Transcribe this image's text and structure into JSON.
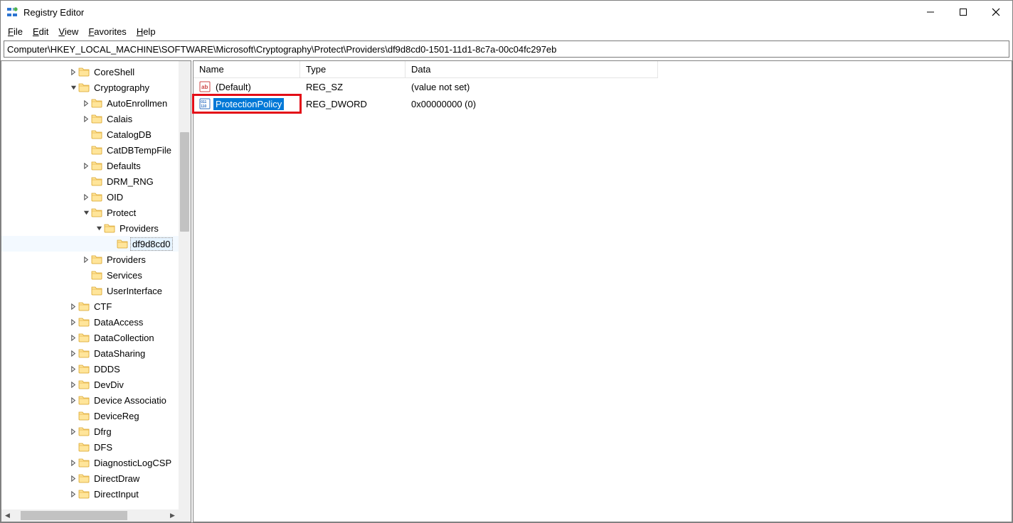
{
  "window": {
    "title": "Registry Editor"
  },
  "menu": {
    "file": "File",
    "edit": "Edit",
    "view": "View",
    "favorites": "Favorites",
    "help": "Help"
  },
  "address": "Computer\\HKEY_LOCAL_MACHINE\\SOFTWARE\\Microsoft\\Cryptography\\Protect\\Providers\\df9d8cd0-1501-11d1-8c7a-00c04fc297eb",
  "tree": [
    {
      "label": "CoreShell",
      "depth": 5,
      "caret": "right"
    },
    {
      "label": "Cryptography",
      "depth": 5,
      "caret": "down"
    },
    {
      "label": "AutoEnrollmen",
      "depth": 6,
      "caret": "right"
    },
    {
      "label": "Calais",
      "depth": 6,
      "caret": "right"
    },
    {
      "label": "CatalogDB",
      "depth": 6,
      "caret": "none"
    },
    {
      "label": "CatDBTempFile",
      "depth": 6,
      "caret": "none"
    },
    {
      "label": "Defaults",
      "depth": 6,
      "caret": "right"
    },
    {
      "label": "DRM_RNG",
      "depth": 6,
      "caret": "none"
    },
    {
      "label": "OID",
      "depth": 6,
      "caret": "right"
    },
    {
      "label": "Protect",
      "depth": 6,
      "caret": "down"
    },
    {
      "label": "Providers",
      "depth": 7,
      "caret": "down"
    },
    {
      "label": "df9d8cd0",
      "depth": 8,
      "caret": "none",
      "selected": true
    },
    {
      "label": "Providers",
      "depth": 6,
      "caret": "right"
    },
    {
      "label": "Services",
      "depth": 6,
      "caret": "none"
    },
    {
      "label": "UserInterface",
      "depth": 6,
      "caret": "none"
    },
    {
      "label": "CTF",
      "depth": 5,
      "caret": "right"
    },
    {
      "label": "DataAccess",
      "depth": 5,
      "caret": "right"
    },
    {
      "label": "DataCollection",
      "depth": 5,
      "caret": "right"
    },
    {
      "label": "DataSharing",
      "depth": 5,
      "caret": "right"
    },
    {
      "label": "DDDS",
      "depth": 5,
      "caret": "right"
    },
    {
      "label": "DevDiv",
      "depth": 5,
      "caret": "right"
    },
    {
      "label": "Device Associatio",
      "depth": 5,
      "caret": "right"
    },
    {
      "label": "DeviceReg",
      "depth": 5,
      "caret": "none"
    },
    {
      "label": "Dfrg",
      "depth": 5,
      "caret": "right"
    },
    {
      "label": "DFS",
      "depth": 5,
      "caret": "none"
    },
    {
      "label": "DiagnosticLogCSP",
      "depth": 5,
      "caret": "right"
    },
    {
      "label": "DirectDraw",
      "depth": 5,
      "caret": "right"
    },
    {
      "label": "DirectInput",
      "depth": 5,
      "caret": "right"
    }
  ],
  "columns": {
    "name": "Name",
    "type": "Type",
    "data": "Data"
  },
  "values": [
    {
      "icon": "sz",
      "name": "(Default)",
      "type": "REG_SZ",
      "data": "(value not set)",
      "selected": false,
      "highlighted": false
    },
    {
      "icon": "dword",
      "name": "ProtectionPolicy",
      "type": "REG_DWORD",
      "data": "0x00000000 (0)",
      "selected": true,
      "highlighted": true
    }
  ]
}
